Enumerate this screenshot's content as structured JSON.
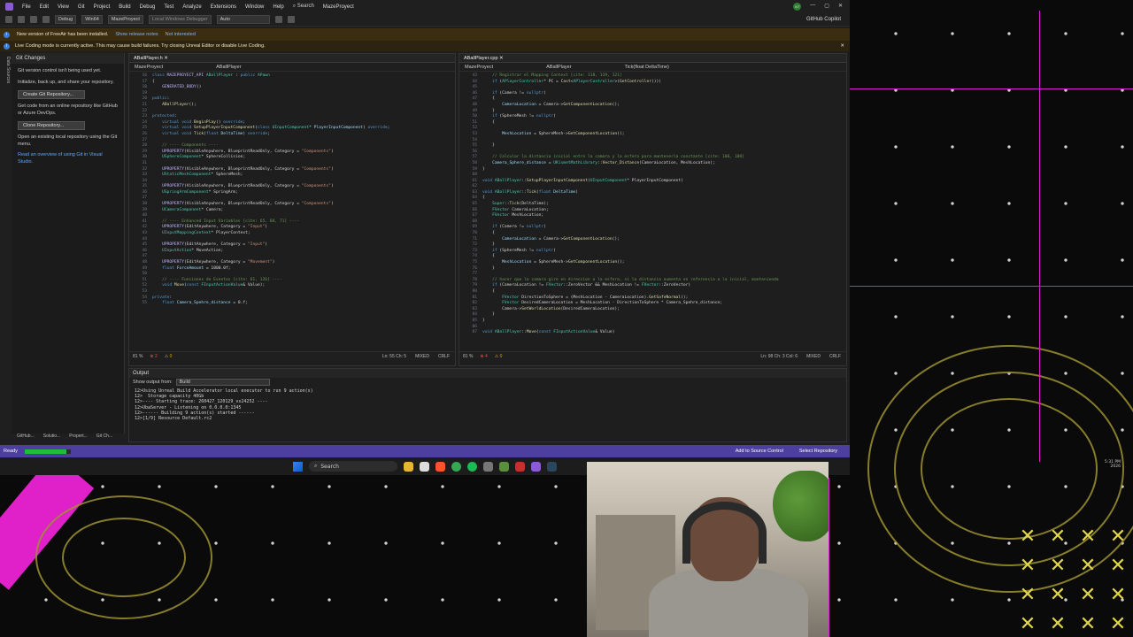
{
  "menubar": {
    "items": [
      "File",
      "Edit",
      "View",
      "Git",
      "Project",
      "Build",
      "Debug",
      "Test",
      "Analyze",
      "Extensions",
      "Window",
      "Help"
    ],
    "search": "Search",
    "solution": "MazeProyect",
    "avatar_initials": "WT"
  },
  "toolbar": {
    "config": "Debug",
    "platform": "Win64",
    "startup": "MazeProyect",
    "debugger": "Local Windows Debugger",
    "mode": "Auto",
    "copilot": "GitHub Copilot"
  },
  "infobar": {
    "message": "New version of FreeAir has been installed.",
    "link1": "Show release notes",
    "link2": "Not interested"
  },
  "livebar": {
    "message": "Live Coding mode is currently active. This may cause build failures. Try closing Unreal Editor or disable Live Coding."
  },
  "sidetabs": "Data Sources",
  "git": {
    "title": "Git Changes",
    "line1": "Git version control isn't being used yet.",
    "line2": "Initialize, back up, and share your repository.",
    "create_button": "Create Git Repository...",
    "line3": "Get code from an online repository like GitHub or Azure DevOps.",
    "clone_button": "Clone Repository...",
    "line4": "Open an existing local repository using the Git menu.",
    "link": "Read an overview of using Git in Visual Studio."
  },
  "bottom_tabs": [
    "GitHub...",
    "Solutio...",
    "Propert...",
    "Git Ch..."
  ],
  "left_editor": {
    "tab": "ABallPlayer.h",
    "scope": "MazeProyect",
    "member": "ABallPlayer",
    "zoom": "81 %",
    "errors": "2",
    "warnings": "0",
    "position": "Ln: 55   Ch: 5",
    "encoding": "MIXED",
    "eol": "CRLF"
  },
  "right_editor": {
    "tab": "ABallPlayer.cpp",
    "scope": "MazeProyect",
    "member": "ABallPlayer",
    "func": "Tick(float DeltaTime)",
    "zoom": "81 %",
    "errors": "4",
    "warnings": "0",
    "position": "Ln: 98   Ch: 3   Col: 6",
    "encoding": "MIXED",
    "eol": "CRLF"
  },
  "output": {
    "title": "Output",
    "show_label": "Show output from:",
    "source": "Build",
    "lines": [
      "12>Using Unreal Build Accelerator local executor to run 9 action(s)",
      "12>  Storage capacity 40Gb",
      "12>---- Starting trace: 260427_120129_vs24252 ----",
      "12>UbaServer - Listening on 0.0.0.0:1345",
      "12>------ Building 9 action(s) started ------",
      "12>[1/9] Resource Default.rc2"
    ]
  },
  "statusbar": {
    "state": "Ready",
    "progress": 0.9,
    "source_control": "Add to Source Control",
    "repository": "Select Repository"
  },
  "taskbar": {
    "search": "Search",
    "time": "5:31 PM",
    "date": "2026"
  },
  "overlay_marks": [
    "✕",
    "✕",
    "✕",
    "✕",
    "✕",
    "✕",
    "✕",
    "✕",
    "✕",
    "✕",
    "✕",
    "✕",
    "✕",
    "✕",
    "✕",
    "✕"
  ]
}
